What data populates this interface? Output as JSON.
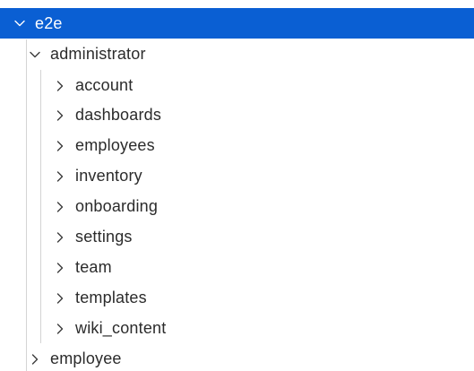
{
  "tree": {
    "root": {
      "label": "e2e",
      "expanded": true,
      "selected": true
    },
    "folder": {
      "label": "administrator",
      "expanded": true
    },
    "children": [
      {
        "label": "account"
      },
      {
        "label": "dashboards"
      },
      {
        "label": "employees"
      },
      {
        "label": "inventory"
      },
      {
        "label": "onboarding"
      },
      {
        "label": "settings"
      },
      {
        "label": "team"
      },
      {
        "label": "templates"
      },
      {
        "label": "wiki_content"
      }
    ],
    "sibling": {
      "label": "employee",
      "expanded": false
    }
  },
  "colors": {
    "selection": "#0a5fd3",
    "text": "#2b2b2b",
    "guide_line": "#d4d4d4"
  }
}
